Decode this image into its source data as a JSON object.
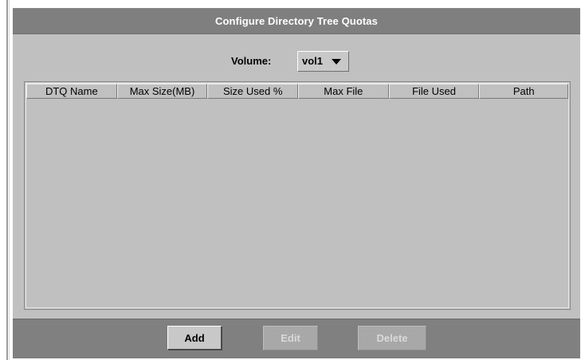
{
  "dialog": {
    "title": "Configure Directory Tree Quotas"
  },
  "volume": {
    "label": "Volume:",
    "selected": "vol1"
  },
  "table": {
    "columns": [
      "DTQ Name",
      "Max Size(MB)",
      "Size Used %",
      "Max File",
      "File Used",
      "Path"
    ],
    "rows": []
  },
  "buttons": {
    "add": "Add",
    "edit": "Edit",
    "delete": "Delete"
  },
  "icons": {
    "dropdown": "caret-down-icon"
  },
  "colors": {
    "panel_bg": "#c0c0c0",
    "titlebar_bg": "#7f7f7f",
    "footer_bg": "#808080",
    "disabled_text": "#d9d9d9"
  }
}
